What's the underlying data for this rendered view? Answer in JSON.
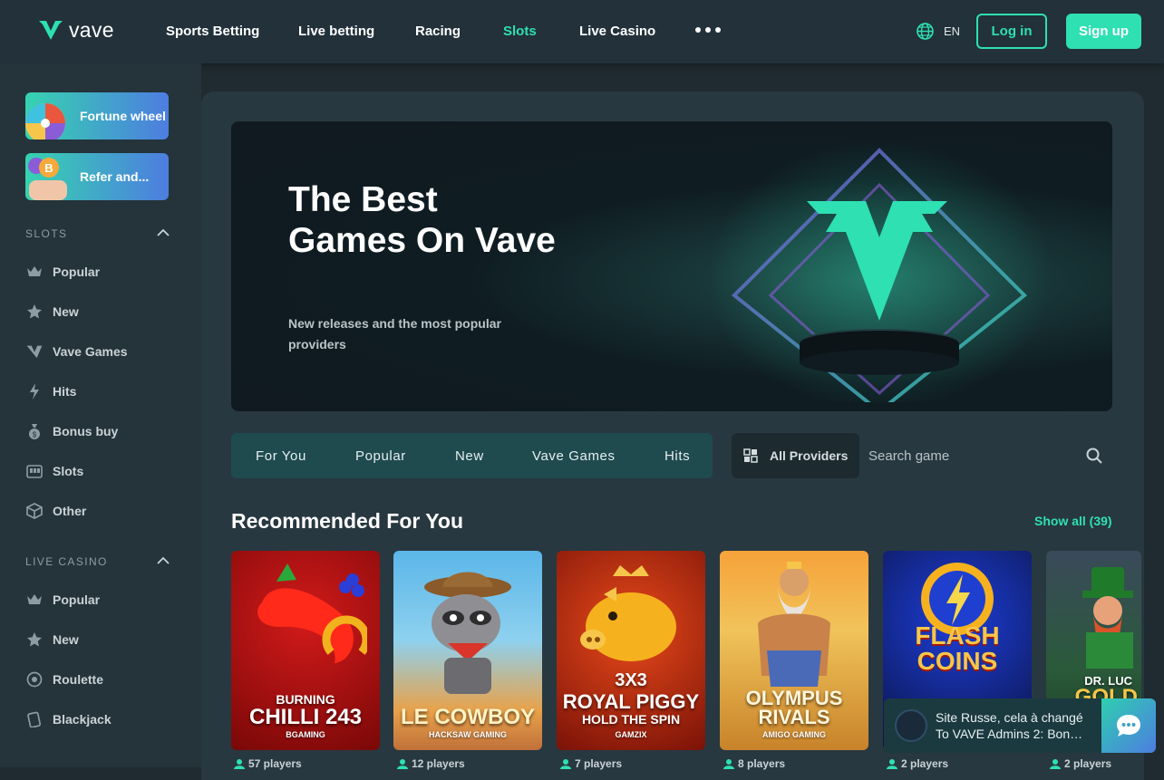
{
  "header": {
    "logo_text": "vave",
    "nav": [
      "Sports Betting",
      "Live betting",
      "Racing",
      "Slots",
      "Live Casino"
    ],
    "active_nav": "Slots",
    "language": "EN",
    "login_label": "Log in",
    "signup_label": "Sign up"
  },
  "sidebar": {
    "promos": [
      "Fortune wheel",
      "Refer and..."
    ],
    "slots_heading": "SLOTS",
    "slots_items": [
      "Popular",
      "New",
      "Vave Games",
      "Hits",
      "Bonus buy",
      "Slots",
      "Other"
    ],
    "live_heading": "LIVE CASINO",
    "live_items": [
      "Popular",
      "New",
      "Roulette",
      "Blackjack"
    ]
  },
  "hero": {
    "title": "The Best Games On Vave",
    "subtitle": "New releases and the most popular providers"
  },
  "filters": {
    "tabs": [
      "For You",
      "Popular",
      "New",
      "Vave Games",
      "Hits"
    ],
    "providers_label": "All Providers",
    "search_placeholder": "Search game"
  },
  "recommended": {
    "title": "Recommended For You",
    "show_all": "Show all (39)",
    "cards": [
      {
        "line1": "BURNING",
        "line2": "CHILLI 243",
        "provider": "BGAMING",
        "players": "57 players"
      },
      {
        "line1": "",
        "line2": "LE COWBOY",
        "provider": "HACKSAW GAMING",
        "players": "12 players"
      },
      {
        "line1": "3X3",
        "line2": "ROYAL PIGGY",
        "line3": "HOLD THE SPIN",
        "provider": "GAMZIX",
        "players": "7 players"
      },
      {
        "line1": "OLYMPUS",
        "line2": "RIVALS",
        "provider": "AMIGO GAMING",
        "players": "8 players"
      },
      {
        "line1": "FLASH",
        "line2": "COINS",
        "provider": "",
        "players": "2 players"
      },
      {
        "line1": "DR. LUC",
        "line2": "GOLD",
        "provider": "",
        "players": "2 players"
      }
    ]
  },
  "chat": {
    "line1": "Site Russe, cela à changé",
    "line2": "To VAVE Admins 2: Bon…"
  },
  "colors": {
    "accent": "#2ee0b2",
    "bg": "#1f2b30",
    "sidebar": "#25333a"
  }
}
